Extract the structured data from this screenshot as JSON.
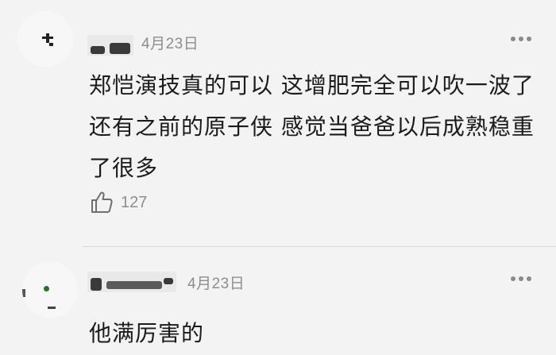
{
  "comments": [
    {
      "username": "",
      "date": "4月23日",
      "text_lines": [
        "郑恺演技真的可以 这增肥完全可以吹一波了",
        "还有之前的原子侠 感觉当爸爸以后成熟稳重",
        "了很多"
      ],
      "likes": "127",
      "like_icon": "thumbs-up-icon",
      "more_icon": "more-dots-icon"
    },
    {
      "username": "",
      "date": "4月23日",
      "text_lines": [
        "他满厉害的"
      ],
      "more_icon": "more-dots-icon"
    }
  ],
  "colors": {
    "background": "#f3f3f3",
    "text": "#1b1b1b",
    "meta": "#8e8e8e",
    "divider": "#dcdcdc"
  }
}
